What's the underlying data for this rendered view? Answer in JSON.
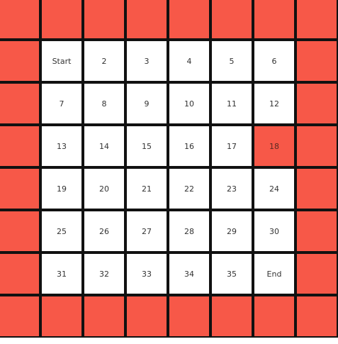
{
  "colors": {
    "wall": "#f75848",
    "open": "#ffffff",
    "border": "#111111"
  },
  "board": {
    "rows": [
      [
        {
          "label": "",
          "type": "wall"
        },
        {
          "label": "",
          "type": "wall"
        },
        {
          "label": "",
          "type": "wall"
        },
        {
          "label": "",
          "type": "wall"
        },
        {
          "label": "",
          "type": "wall"
        },
        {
          "label": "",
          "type": "wall"
        },
        {
          "label": "",
          "type": "wall"
        },
        {
          "label": "",
          "type": "wall"
        }
      ],
      [
        {
          "label": "",
          "type": "wall"
        },
        {
          "label": "Start",
          "type": "open"
        },
        {
          "label": "2",
          "type": "open"
        },
        {
          "label": "3",
          "type": "open"
        },
        {
          "label": "4",
          "type": "open"
        },
        {
          "label": "5",
          "type": "open"
        },
        {
          "label": "6",
          "type": "open"
        },
        {
          "label": "",
          "type": "wall"
        }
      ],
      [
        {
          "label": "",
          "type": "wall"
        },
        {
          "label": "7",
          "type": "open"
        },
        {
          "label": "8",
          "type": "open"
        },
        {
          "label": "9",
          "type": "open"
        },
        {
          "label": "10",
          "type": "open"
        },
        {
          "label": "11",
          "type": "open"
        },
        {
          "label": "12",
          "type": "open"
        },
        {
          "label": "",
          "type": "wall"
        }
      ],
      [
        {
          "label": "",
          "type": "wall"
        },
        {
          "label": "13",
          "type": "open"
        },
        {
          "label": "14",
          "type": "open"
        },
        {
          "label": "15",
          "type": "open"
        },
        {
          "label": "16",
          "type": "open"
        },
        {
          "label": "17",
          "type": "open"
        },
        {
          "label": "18",
          "type": "wall"
        },
        {
          "label": "",
          "type": "wall"
        }
      ],
      [
        {
          "label": "",
          "type": "wall"
        },
        {
          "label": "19",
          "type": "open"
        },
        {
          "label": "20",
          "type": "open"
        },
        {
          "label": "21",
          "type": "open"
        },
        {
          "label": "22",
          "type": "open"
        },
        {
          "label": "23",
          "type": "open"
        },
        {
          "label": "24",
          "type": "open"
        },
        {
          "label": "",
          "type": "wall"
        }
      ],
      [
        {
          "label": "",
          "type": "wall"
        },
        {
          "label": "25",
          "type": "open"
        },
        {
          "label": "26",
          "type": "open"
        },
        {
          "label": "27",
          "type": "open"
        },
        {
          "label": "28",
          "type": "open"
        },
        {
          "label": "29",
          "type": "open"
        },
        {
          "label": "30",
          "type": "open"
        },
        {
          "label": "",
          "type": "wall"
        }
      ],
      [
        {
          "label": "",
          "type": "wall"
        },
        {
          "label": "31",
          "type": "open"
        },
        {
          "label": "32",
          "type": "open"
        },
        {
          "label": "33",
          "type": "open"
        },
        {
          "label": "34",
          "type": "open"
        },
        {
          "label": "35",
          "type": "open"
        },
        {
          "label": "End",
          "type": "open"
        },
        {
          "label": "",
          "type": "wall"
        }
      ],
      [
        {
          "label": "",
          "type": "wall"
        },
        {
          "label": "",
          "type": "wall"
        },
        {
          "label": "",
          "type": "wall"
        },
        {
          "label": "",
          "type": "wall"
        },
        {
          "label": "",
          "type": "wall"
        },
        {
          "label": "",
          "type": "wall"
        },
        {
          "label": "",
          "type": "wall"
        },
        {
          "label": "",
          "type": "wall"
        }
      ]
    ]
  }
}
